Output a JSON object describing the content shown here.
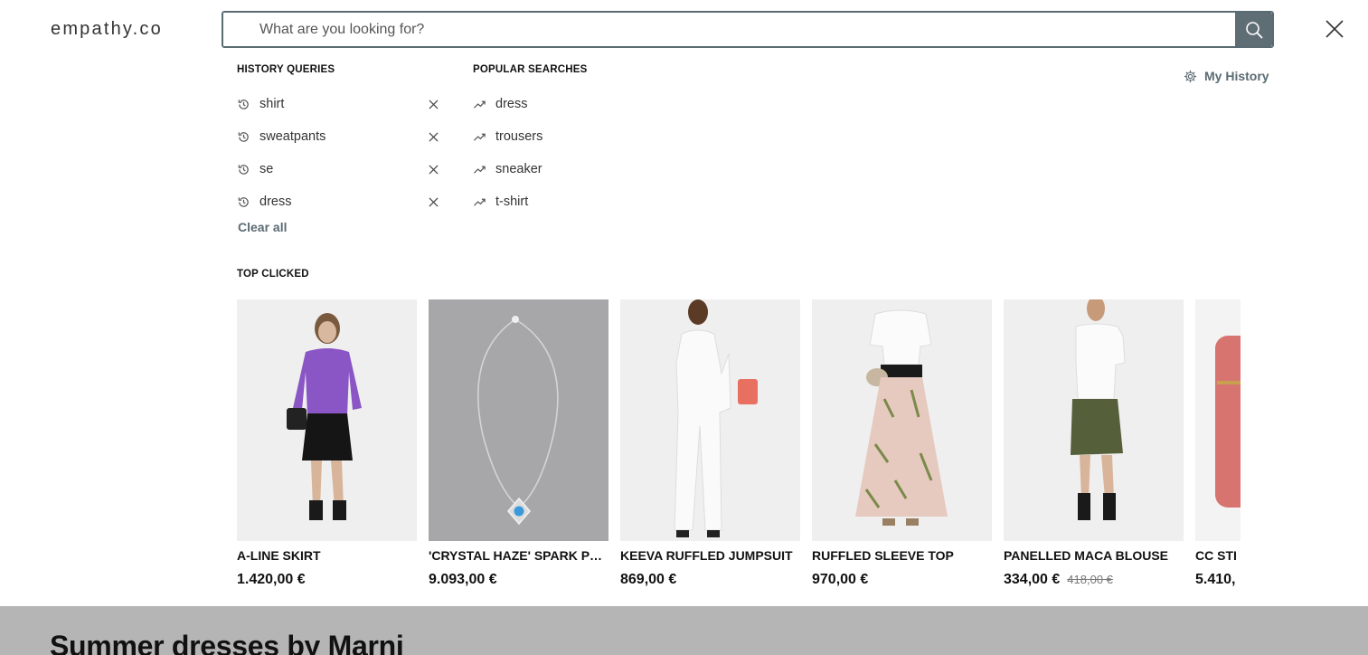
{
  "logo": "empathy.co",
  "search": {
    "placeholder": "What are you looking for?",
    "value": ""
  },
  "history": {
    "title": "HISTORY QUERIES",
    "items": [
      "shirt",
      "sweatpants",
      "se",
      "dress"
    ],
    "clear_label": "Clear all"
  },
  "popular": {
    "title": "POPULAR SEARCHES",
    "items": [
      "dress",
      "trousers",
      "sneaker",
      "t-shirt"
    ]
  },
  "my_history_label": "My History",
  "top_clicked": {
    "title": "TOP CLICKED",
    "products": [
      {
        "name": "A-LINE SKIRT",
        "price": "1.420,00 €",
        "old_price": ""
      },
      {
        "name": "'CRYSTAL HAZE' SPARK PE...",
        "price": "9.093,00 €",
        "old_price": ""
      },
      {
        "name": "KEEVA RUFFLED JUMPSUIT",
        "price": "869,00 €",
        "old_price": ""
      },
      {
        "name": "RUFFLED SLEEVE TOP",
        "price": "970,00 €",
        "old_price": ""
      },
      {
        "name": "PANELLED MACA BLOUSE",
        "price": "334,00 €",
        "old_price": "418,00 €"
      },
      {
        "name": "CC STI",
        "price": "5.410,",
        "old_price": ""
      }
    ]
  },
  "banner_title": "Summer dresses by Marni",
  "colors": {
    "accent": "#5b6b73",
    "banner_bg": "#b5b5b5"
  }
}
